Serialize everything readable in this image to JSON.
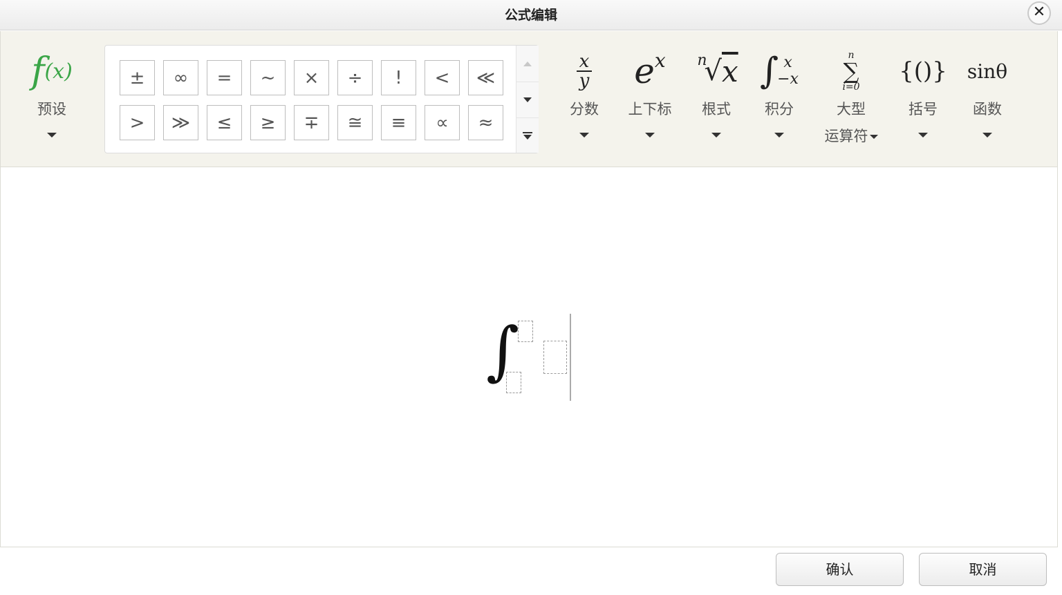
{
  "window": {
    "title": "公式编辑",
    "close_label": "✕"
  },
  "toolbar": {
    "preset": {
      "glyph_f": "f",
      "glyph_x": "(x)",
      "label": "预设"
    },
    "symbols": {
      "row1": [
        "±",
        "∞",
        "=",
        "~",
        "×",
        "÷",
        "!",
        "<",
        "≪"
      ],
      "row2": [
        ">",
        "≫",
        "≤",
        "≥",
        "∓",
        "≅",
        "≡",
        "∝",
        "≈"
      ]
    },
    "groups": {
      "fraction": {
        "num": "x",
        "den": "y",
        "label": "分数"
      },
      "script": {
        "base": "e",
        "sup": "x",
        "label": "上下标"
      },
      "radical": {
        "index": "n",
        "sign": "√",
        "body": "x",
        "label": "根式"
      },
      "integral": {
        "sign": "∫",
        "upper": "x",
        "lower": "−x",
        "label": "积分"
      },
      "large_op": {
        "upper": "n",
        "sign": "∑",
        "lower": "i=0",
        "label": "大型",
        "label2": "运算符"
      },
      "bracket": {
        "glyph": "{()}",
        "label": "括号"
      },
      "function": {
        "glyph": "sinθ",
        "label": "函数"
      }
    }
  },
  "editor": {
    "integral_sign": "∫"
  },
  "footer": {
    "ok_label": "确认",
    "cancel_label": "取消"
  }
}
